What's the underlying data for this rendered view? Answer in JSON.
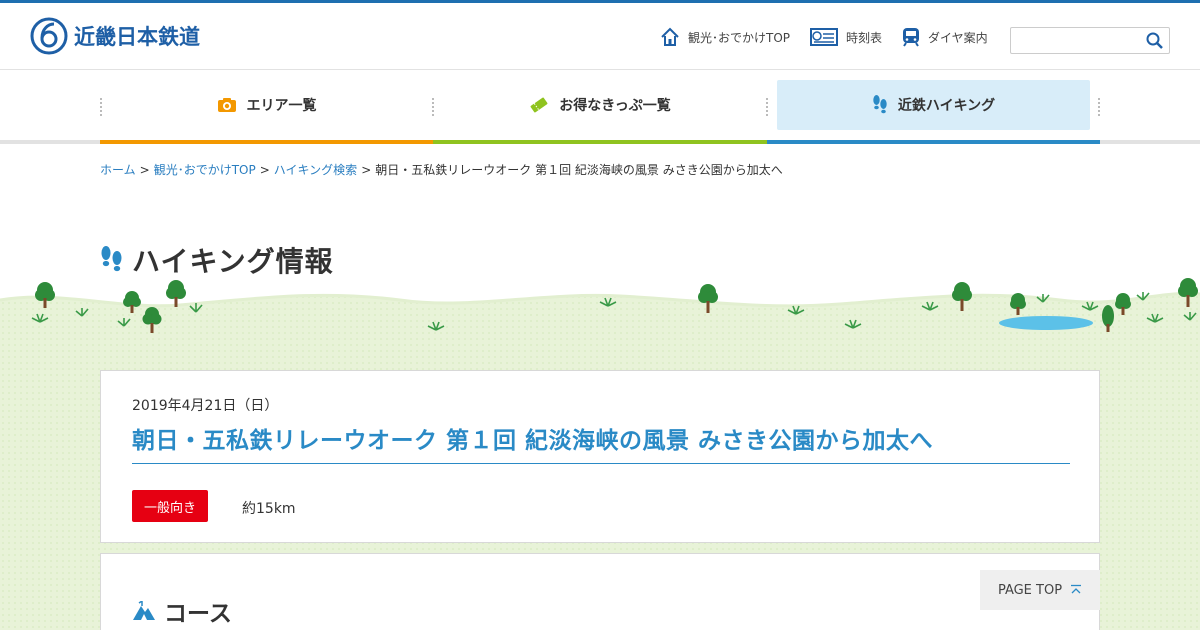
{
  "header": {
    "logo_text": "近畿日本鉄道",
    "utils": [
      {
        "label": "観光･おでかけTOP",
        "icon": "home-icon"
      },
      {
        "label": "時刻表",
        "icon": "timetable-icon"
      },
      {
        "label": "ダイヤ案内",
        "icon": "train-icon"
      }
    ],
    "search": {
      "placeholder": "",
      "value": ""
    }
  },
  "nav": {
    "items": [
      {
        "label": "エリア一覧",
        "icon": "camera-icon",
        "color": "#f39800"
      },
      {
        "label": "お得なきっぷ一覧",
        "icon": "ticket-icon",
        "color": "#8fc31f"
      },
      {
        "label": "近鉄ハイキング",
        "icon": "footprints-icon",
        "color": "#2a8ac6",
        "active": true
      }
    ]
  },
  "breadcrumb": {
    "items": [
      "ホーム",
      "観光･おでかけTOP",
      "ハイキング検索"
    ],
    "current": "朝日・五私鉄リレーウオーク 第１回 紀淡海峡の風景 みさき公園から加太へ"
  },
  "page": {
    "title": "ハイキング情報"
  },
  "event": {
    "date": "2019年4月21日（日）",
    "title": "朝日・五私鉄リレーウオーク 第１回 紀淡海峡の風景 みさき公園から加太へ",
    "level": "一般向き",
    "distance": "約15km"
  },
  "course": {
    "heading": "コース"
  },
  "pagetop": {
    "label": "PAGE TOP"
  },
  "colors": {
    "brand": "#1e5fa6",
    "accent_blue": "#2a8ac6",
    "badge_red": "#e60012",
    "grass": "#e6f2d3"
  }
}
